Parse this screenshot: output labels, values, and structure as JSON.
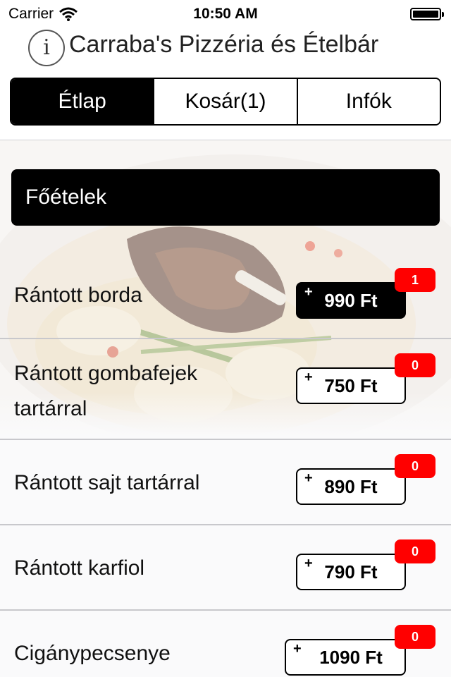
{
  "status_bar": {
    "carrier": "Carrier",
    "time": "10:50 AM"
  },
  "header": {
    "info_glyph": "i",
    "title": "Carraba's Pizzéria és Ételbár",
    "tabs": [
      {
        "label": "Étlap",
        "active": true
      },
      {
        "label": "Kosár(1)",
        "active": false
      },
      {
        "label": "Infók",
        "active": false
      }
    ]
  },
  "menu": {
    "section_title": "Főételek",
    "items": [
      {
        "name": "Rántott borda",
        "price": "990 Ft",
        "count": "1",
        "selected": true
      },
      {
        "name": "Rántott gombafejek tartárral",
        "price": "750 Ft",
        "count": "0",
        "selected": false
      },
      {
        "name": "Rántott sajt tartárral",
        "price": "890 Ft",
        "count": "0",
        "selected": false
      },
      {
        "name": "Rántott karfiol",
        "price": "790 Ft",
        "count": "0",
        "selected": false
      },
      {
        "name": "Cigánypecsenye",
        "price": "1090 Ft",
        "count": "0",
        "selected": false
      }
    ],
    "plus_symbol": "+"
  },
  "colors": {
    "badge": "#ff0000",
    "accent": "#000000",
    "background": "#fafafb"
  }
}
